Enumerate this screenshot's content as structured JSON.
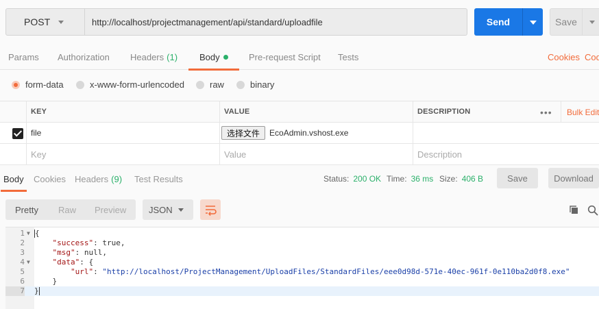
{
  "request": {
    "method": "POST",
    "url": "http://localhost/projectmanagement/api/standard/uploadfile",
    "send_label": "Send",
    "save_label": "Save"
  },
  "request_tabs": {
    "params": "Params",
    "authorization": "Authorization",
    "headers": "Headers",
    "headers_count": "(1)",
    "body": "Body",
    "prerequest": "Pre-request Script",
    "tests": "Tests",
    "cookies": "Cookies",
    "code": "Code"
  },
  "body_types": {
    "form_data": "form-data",
    "urlencoded": "x-www-form-urlencoded",
    "raw": "raw",
    "binary": "binary",
    "selected": "form-data"
  },
  "form_table": {
    "headers": {
      "key": "KEY",
      "value": "VALUE",
      "description": "DESCRIPTION",
      "more": "•••",
      "bulk_edit": "Bulk Edit"
    },
    "row": {
      "key": "file",
      "file_button": "选择文件",
      "file_name": "EcoAdmin.vshost.exe",
      "checked": true
    },
    "placeholders": {
      "key": "Key",
      "value": "Value",
      "description": "Description"
    }
  },
  "response_tabs": {
    "body": "Body",
    "cookies": "Cookies",
    "headers": "Headers",
    "headers_count": "(9)",
    "test_results": "Test Results"
  },
  "response_status": {
    "status_label": "Status:",
    "status_value": "200 OK",
    "time_label": "Time:",
    "time_value": "36 ms",
    "size_label": "Size:",
    "size_value": "406 B",
    "save_button": "Save",
    "download_button": "Download"
  },
  "response_view": {
    "pretty": "Pretty",
    "raw": "Raw",
    "preview": "Preview",
    "format": "JSON"
  },
  "response_body": {
    "lines": [
      {
        "n": "1",
        "text": "{"
      },
      {
        "n": "2",
        "key": "\"success\"",
        "value": "true,"
      },
      {
        "n": "3",
        "key": "\"msg\"",
        "value": "null,"
      },
      {
        "n": "4",
        "key": "\"data\"",
        "value": "{"
      },
      {
        "n": "5",
        "key": "\"url\"",
        "str": "\"http://localhost/ProjectManagement/UploadFiles/StandardFiles/eee0d98d-571e-40ec-961f-0e110ba2d0f8.exe\""
      },
      {
        "n": "6",
        "text": "}"
      },
      {
        "n": "7",
        "text": "}"
      }
    ]
  },
  "colors": {
    "accent": "#f26b3a",
    "primary": "#1a78e6",
    "success": "#2bb06a"
  },
  "icons": {
    "copy": "copy-icon",
    "search": "search-icon",
    "wrap": "wrap-lines-icon"
  }
}
